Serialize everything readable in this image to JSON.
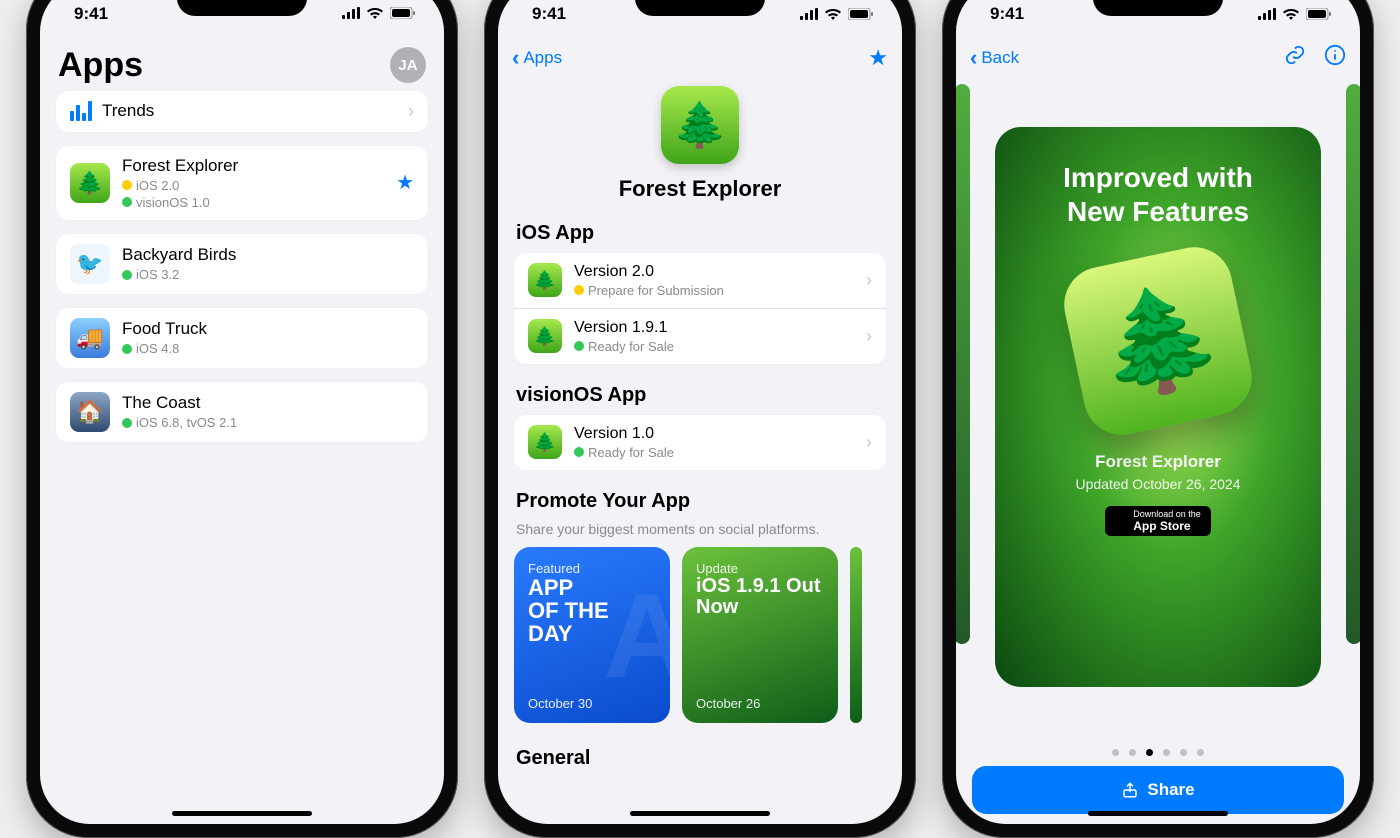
{
  "status": {
    "time": "9:41"
  },
  "phone1": {
    "title": "Apps",
    "avatar": "JA",
    "trends": "Trends",
    "apps": [
      {
        "name": "Forest Explorer",
        "lines": [
          {
            "dot": "yellow",
            "text": "iOS 2.0"
          },
          {
            "dot": "green",
            "text": "visionOS 1.0"
          }
        ],
        "starred": true,
        "icon": "forest"
      },
      {
        "name": "Backyard Birds",
        "lines": [
          {
            "dot": "green",
            "text": "iOS 3.2"
          }
        ],
        "icon": "birds"
      },
      {
        "name": "Food Truck",
        "lines": [
          {
            "dot": "green",
            "text": "iOS 4.8"
          }
        ],
        "icon": "truck"
      },
      {
        "name": "The Coast",
        "lines": [
          {
            "dot": "green",
            "text": "iOS 6.8, tvOS 2.1"
          }
        ],
        "icon": "coast"
      }
    ]
  },
  "phone2": {
    "back": "Apps",
    "app_name": "Forest Explorer",
    "sections": {
      "ios": {
        "title": "iOS App",
        "versions": [
          {
            "version": "Version 2.0",
            "status": "Prepare for Submission",
            "dot": "yellow"
          },
          {
            "version": "Version 1.9.1",
            "status": "Ready for Sale",
            "dot": "green"
          }
        ]
      },
      "visionos": {
        "title": "visionOS App",
        "versions": [
          {
            "version": "Version 1.0",
            "status": "Ready for Sale",
            "dot": "green"
          }
        ]
      },
      "promote": {
        "title": "Promote Your App",
        "subtitle": "Share your biggest moments on social platforms.",
        "cards": [
          {
            "eyebrow": "Featured",
            "big": "APP\nOF THE\nDAY",
            "date": "October 30",
            "color": "blue"
          },
          {
            "eyebrow": "Update",
            "big": "iOS 1.9.1 Out Now",
            "date": "October 26",
            "color": "green"
          }
        ]
      },
      "general": {
        "title": "General"
      }
    }
  },
  "phone3": {
    "back": "Back",
    "slide": {
      "headline1": "Improved with",
      "headline2": "New Features",
      "app": "Forest Explorer",
      "sub": "Updated October 26, 2024",
      "badge_small": "Download on the",
      "badge_big": "App Store"
    },
    "share": "Share",
    "pager_total": 6,
    "pager_active": 3
  }
}
